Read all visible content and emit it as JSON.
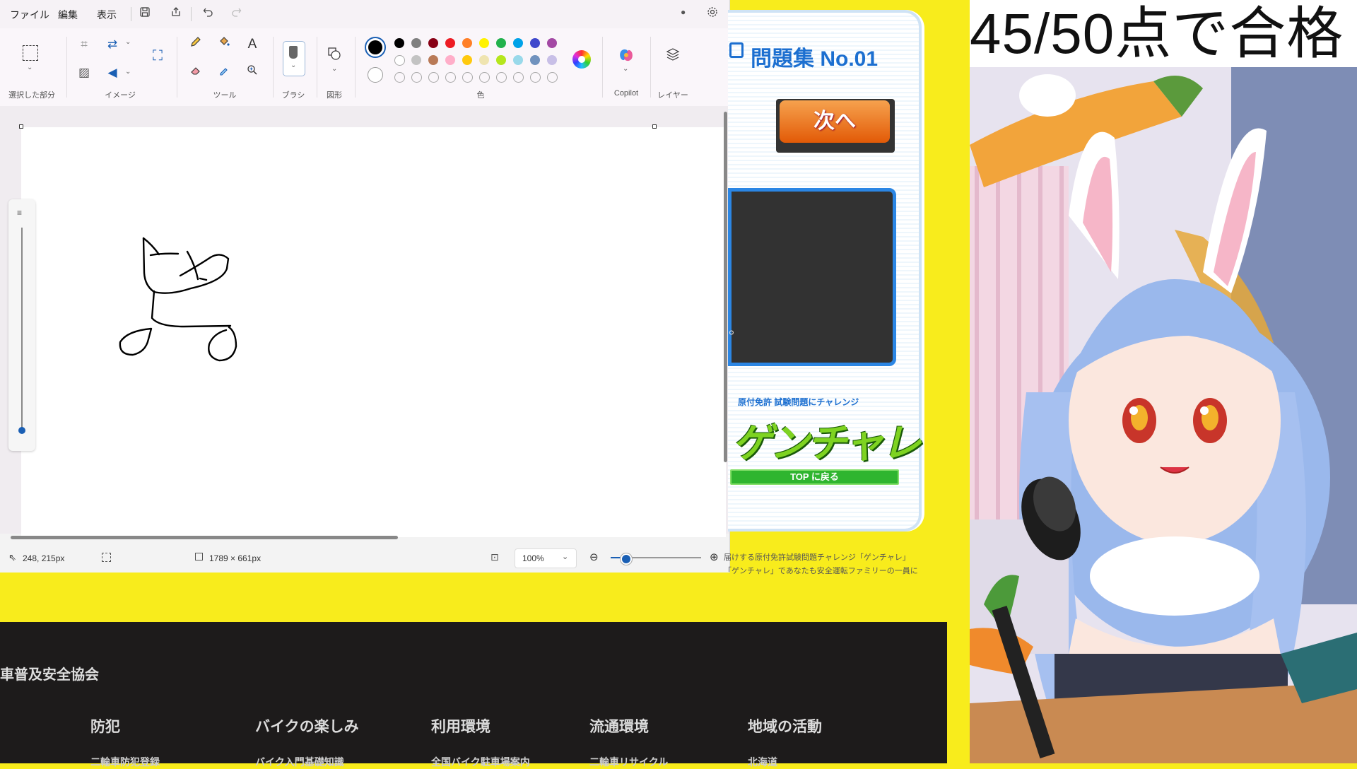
{
  "paint": {
    "menu": [
      "ファイル",
      "編集",
      "表示"
    ],
    "ribbon_groups": {
      "selection": "選択した部分",
      "image": "イメージ",
      "tools": "ツール",
      "brush": "ブラシ",
      "shapes": "図形",
      "colors": "色",
      "copilot": "Copilot",
      "layers": "レイヤー"
    },
    "palette": {
      "row1": [
        "#000000",
        "#7f7f7f",
        "#880015",
        "#ed1c24",
        "#ff7f27",
        "#fff200",
        "#22b14c",
        "#00a2e8",
        "#3f48cc",
        "#a349a4"
      ],
      "row2": [
        "#ffffff",
        "#c3c3c3",
        "#b97a57",
        "#ffaec9",
        "#ffc90e",
        "#efe4b0",
        "#b5e61d",
        "#99d9ea",
        "#7092be",
        "#c8bfe7"
      ],
      "primary": "#000000",
      "secondary": "#ffffff"
    },
    "status": {
      "cursor_pos": "248, 215px",
      "canvas_size": "1789 × 661px",
      "zoom": "100%"
    }
  },
  "quiz": {
    "title": "問題集 No.01",
    "next_button": "次へ",
    "question_fragment": "。",
    "banner_sub": "原付免許 試験問題にチャレンジ",
    "banner_logo": "ゲンチャレ",
    "top_link": "TOP に戻る",
    "desc_line1": "届けする原付免許試験問題チャレンジ「ゲンチャレ」",
    "desc_line2": "「ゲンチャレ」であなたも安全運転ファミリーの一員に"
  },
  "footer": {
    "org": "車普及安全協会",
    "headings": [
      "防犯",
      "バイクの楽しみ",
      "利用環境",
      "流通環境",
      "地域の活動"
    ],
    "subs": [
      "二輪車防犯登録",
      "バイク入門基礎知識",
      "全国バイク駐車場案内",
      "二輪車リサイクル",
      "北海道"
    ]
  },
  "overlay": {
    "score": "45/50点で合格"
  },
  "colors": {
    "background_yellow": "#f8ec1c",
    "footer_dark": "#1d1b1b",
    "quiz_blue": "#1c6fd0",
    "next_orange": "#ee6a12",
    "top_green": "#2fb52f"
  }
}
